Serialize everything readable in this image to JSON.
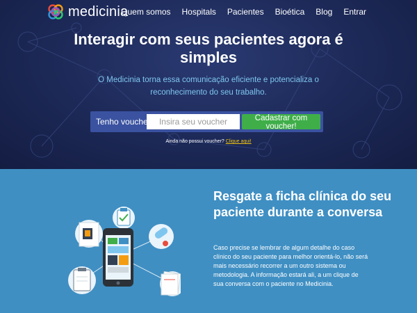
{
  "brand": {
    "name": "medicinia"
  },
  "nav": {
    "items": [
      "Quem somos",
      "Hospitals",
      "Pacientes",
      "Bioética",
      "Blog",
      "Entrar"
    ]
  },
  "hero": {
    "headline": "Interagir com seus pacientes agora é simples",
    "sub": "O Medicinia torna essa comunicação eficiente e potencializa o reconhecimento do seu trabalho.",
    "voucher_label": "Tenho voucher",
    "voucher_placeholder": "Insira seu voucher",
    "voucher_button": "Cadastrar com voucher!",
    "no_voucher_text": "Ainda não possui voucher?",
    "no_voucher_link": "Clique aqui!"
  },
  "section2": {
    "title": "Resgate a ficha clínica do seu paciente durante a conversa",
    "text": "Caso precise se lembrar de algum detalhe do caso clínico do seu paciente para melhor orientá-lo, não será mais necessário recorrer a um outro sistema ou metodologia. A informação estará ali, a um clique de sua conversa com o paciente no Medicinia."
  },
  "colors": {
    "hero_bg": "#1c2856",
    "accent_green": "#3fae49",
    "section_blue": "#3f8fc3",
    "link_yellow": "#f1c40f",
    "voucher_bar": "#3a52a0"
  }
}
